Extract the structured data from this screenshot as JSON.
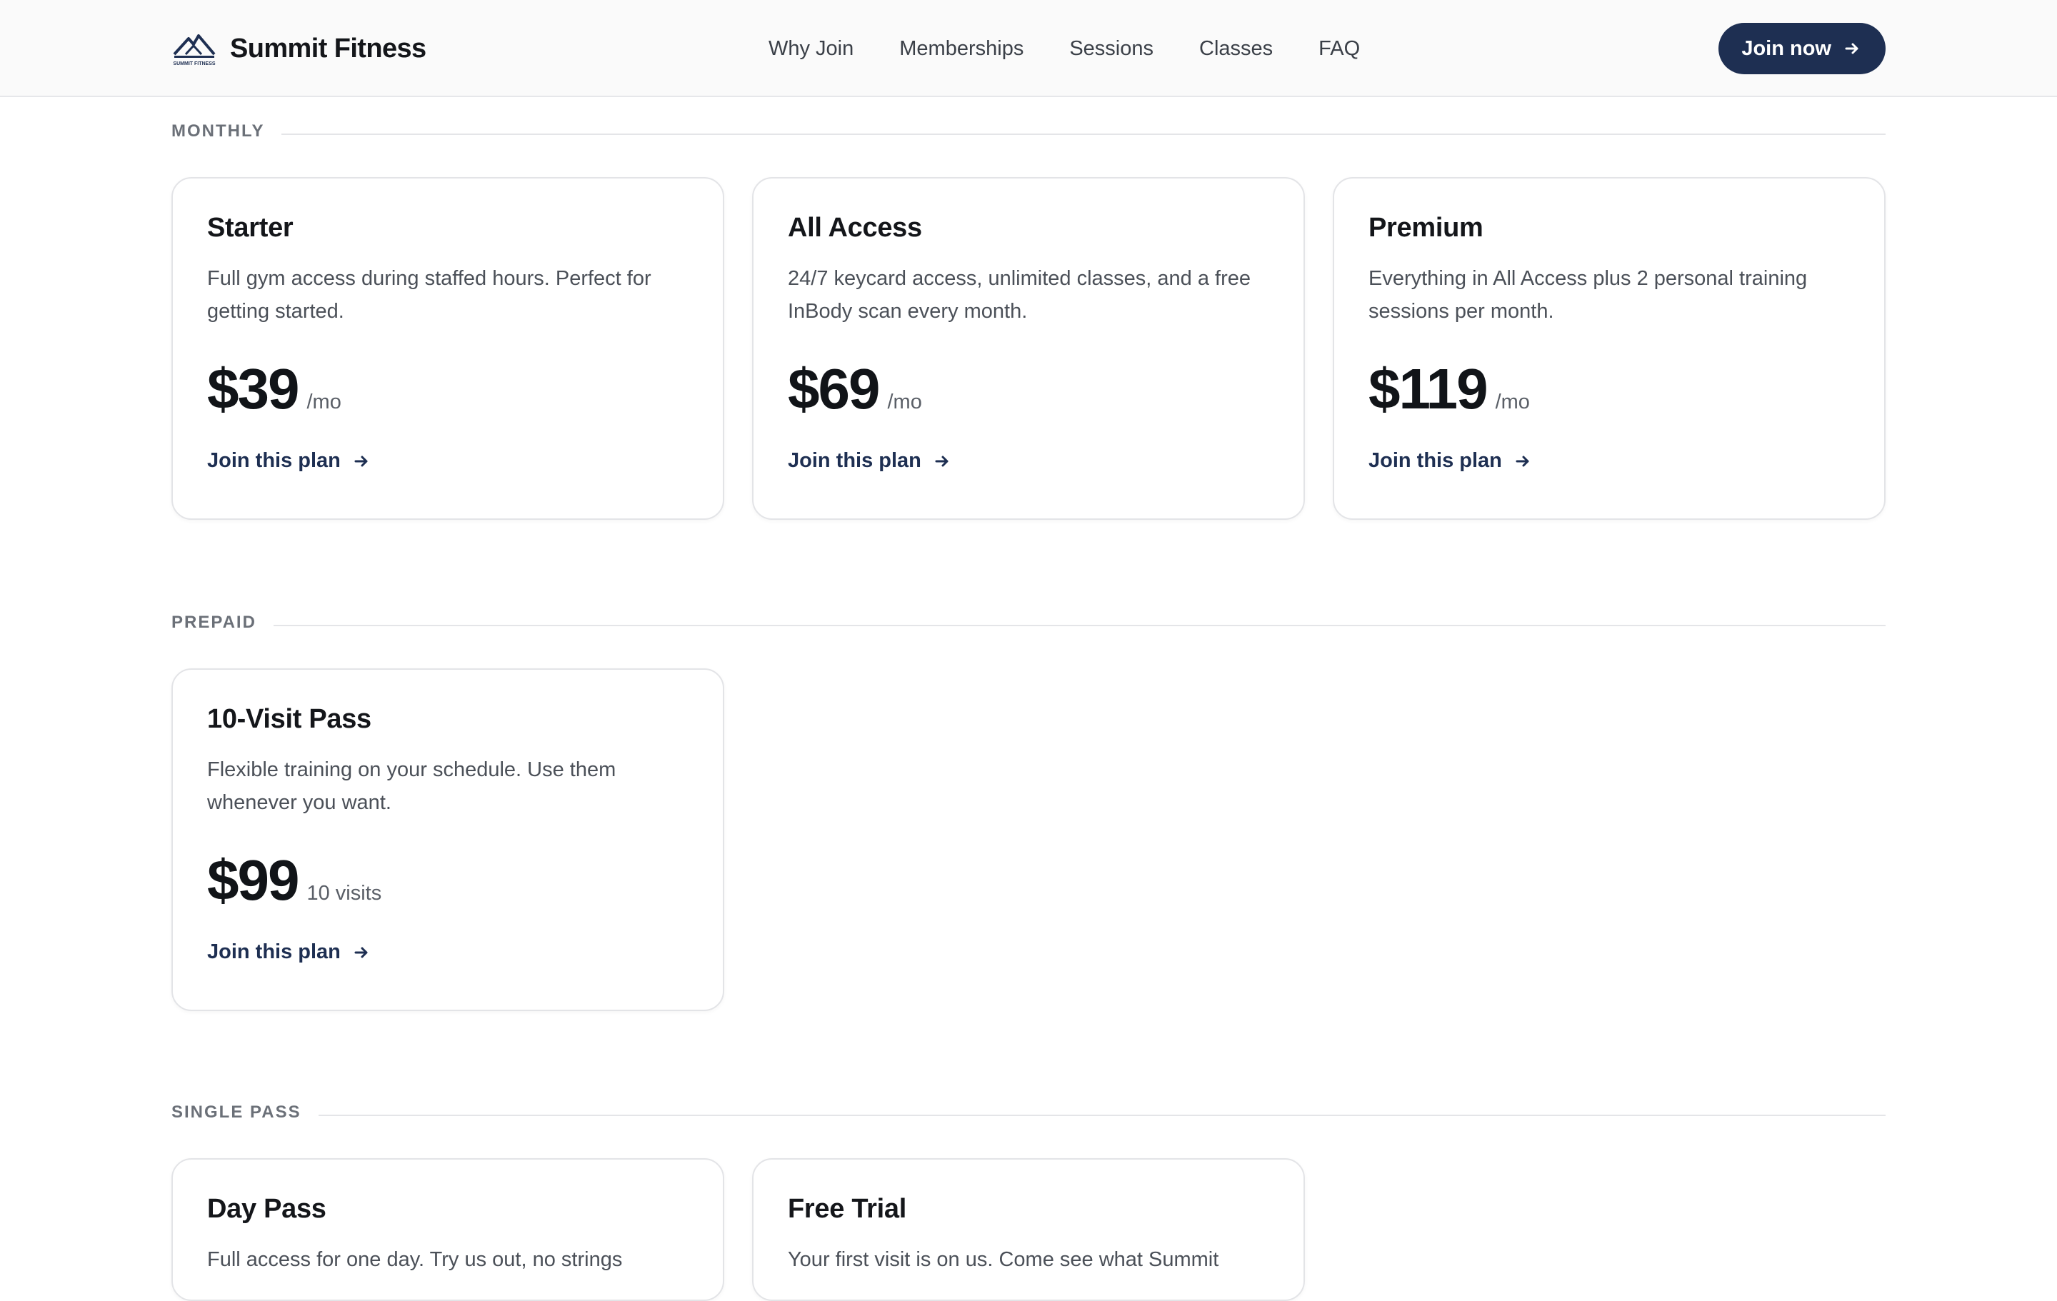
{
  "brand": {
    "name": "Summit Fitness",
    "logo_icon": "mountain-logo-icon",
    "logo_text": "SUMMIT FITNESS"
  },
  "nav": {
    "items": [
      "Why Join",
      "Memberships",
      "Sessions",
      "Classes",
      "FAQ"
    ]
  },
  "header": {
    "cta_label": "Join now",
    "cta_icon": "arrow-right-icon"
  },
  "colors": {
    "accent": "#1e2f52",
    "text": "#111418",
    "muted": "#4b5058",
    "border": "#e3e4e7"
  },
  "sections": [
    {
      "label": "MONTHLY",
      "plans": [
        {
          "title": "Starter",
          "description": "Full gym access during staffed hours. Perfect for getting started.",
          "price": "$39",
          "unit": "/mo",
          "cta": "Join this plan"
        },
        {
          "title": "All Access",
          "description": "24/7 keycard access, unlimited classes, and a free InBody scan every month.",
          "price": "$69",
          "unit": "/mo",
          "cta": "Join this plan"
        },
        {
          "title": "Premium",
          "description": "Everything in All Access plus 2 personal training sessions per month.",
          "price": "$119",
          "unit": "/mo",
          "cta": "Join this plan"
        }
      ]
    },
    {
      "label": "PREPAID",
      "plans": [
        {
          "title": "10-Visit Pass",
          "description": "Flexible training on your schedule. Use them whenever you want.",
          "price": "$99",
          "unit": "10 visits",
          "cta": "Join this plan"
        }
      ]
    },
    {
      "label": "SINGLE PASS",
      "plans": [
        {
          "title": "Day Pass",
          "description": "Full access for one day. Try us out, no strings"
        },
        {
          "title": "Free Trial",
          "description": "Your first visit is on us. Come see what Summit"
        }
      ]
    }
  ]
}
